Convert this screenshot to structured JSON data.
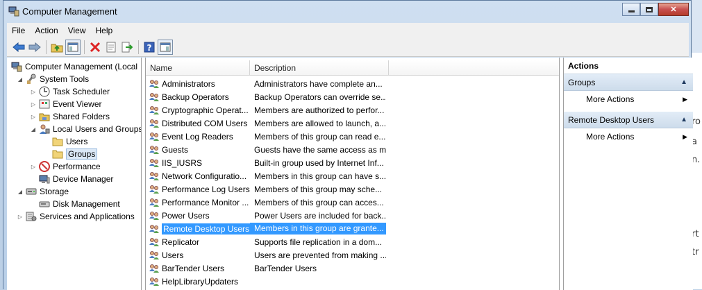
{
  "window": {
    "title": "Computer Management"
  },
  "menu": [
    "File",
    "Action",
    "View",
    "Help"
  ],
  "toolbar": {
    "buttons": [
      "back-arrow-icon",
      "forward-arrow-icon",
      "up-folder-icon",
      "show-hide-tree-icon",
      "delete-icon",
      "properties-icon",
      "export-list-icon",
      "help-icon",
      "show-hide-action-pane-icon"
    ]
  },
  "tree": {
    "items": [
      {
        "label": "Computer Management (Local",
        "arrow": "",
        "icon": "computer-management-icon"
      },
      {
        "label": "System Tools",
        "arrow": "◢",
        "icon": "system-tools-icon"
      },
      {
        "label": "Task Scheduler",
        "arrow": "▷",
        "icon": "task-scheduler-icon"
      },
      {
        "label": "Event Viewer",
        "arrow": "▷",
        "icon": "event-viewer-icon"
      },
      {
        "label": "Shared Folders",
        "arrow": "▷",
        "icon": "shared-folders-icon"
      },
      {
        "label": "Local Users and Groups",
        "arrow": "◢",
        "icon": "local-users-groups-icon"
      },
      {
        "label": "Users",
        "arrow": "",
        "icon": "folder-icon"
      },
      {
        "label": "Groups",
        "arrow": "",
        "icon": "folder-icon"
      },
      {
        "label": "Performance",
        "arrow": "▷",
        "icon": "performance-icon"
      },
      {
        "label": "Device Manager",
        "arrow": "",
        "icon": "device-manager-icon"
      },
      {
        "label": "Storage",
        "arrow": "◢",
        "icon": "storage-icon"
      },
      {
        "label": "Disk Management",
        "arrow": "",
        "icon": "disk-management-icon"
      },
      {
        "label": "Services and Applications",
        "arrow": "▷",
        "icon": "services-applications-icon"
      }
    ]
  },
  "list": {
    "columns": [
      "Name",
      "Description"
    ],
    "rows": [
      {
        "name": "Administrators",
        "desc": "Administrators have complete an..."
      },
      {
        "name": "Backup Operators",
        "desc": "Backup Operators can override se..."
      },
      {
        "name": "Cryptographic Operat...",
        "desc": "Members are authorized to perfor..."
      },
      {
        "name": "Distributed COM Users",
        "desc": "Members are allowed to launch, a..."
      },
      {
        "name": "Event Log Readers",
        "desc": "Members of this group can read e..."
      },
      {
        "name": "Guests",
        "desc": "Guests have the same access as m..."
      },
      {
        "name": "IIS_IUSRS",
        "desc": "Built-in group used by Internet Inf..."
      },
      {
        "name": "Network Configuratio...",
        "desc": "Members in this group can have s..."
      },
      {
        "name": "Performance Log Users",
        "desc": "Members of this group may sche..."
      },
      {
        "name": "Performance Monitor ...",
        "desc": "Members of this group can acces..."
      },
      {
        "name": "Power Users",
        "desc": "Power Users are included for back..."
      },
      {
        "name": "Remote Desktop Users",
        "desc": "Members in this group are grante..."
      },
      {
        "name": "Replicator",
        "desc": "Supports file replication in a dom..."
      },
      {
        "name": "Users",
        "desc": "Users are prevented from making ..."
      },
      {
        "name": "BarTender Users",
        "desc": "BarTender Users"
      },
      {
        "name": "HelpLibraryUpdaters",
        "desc": ""
      }
    ],
    "selected_index": 11
  },
  "actions": {
    "title": "Actions",
    "group1": "Groups",
    "more1": "More Actions",
    "group2": "Remote Desktop Users",
    "more2": "More Actions"
  },
  "background_fragments": [
    "ro",
    "a",
    "n.",
    "rt",
    "tr"
  ],
  "colors": {
    "selection": "#3399ff",
    "tree_selection": "#dbe8f6",
    "close_button": "#c75050"
  }
}
